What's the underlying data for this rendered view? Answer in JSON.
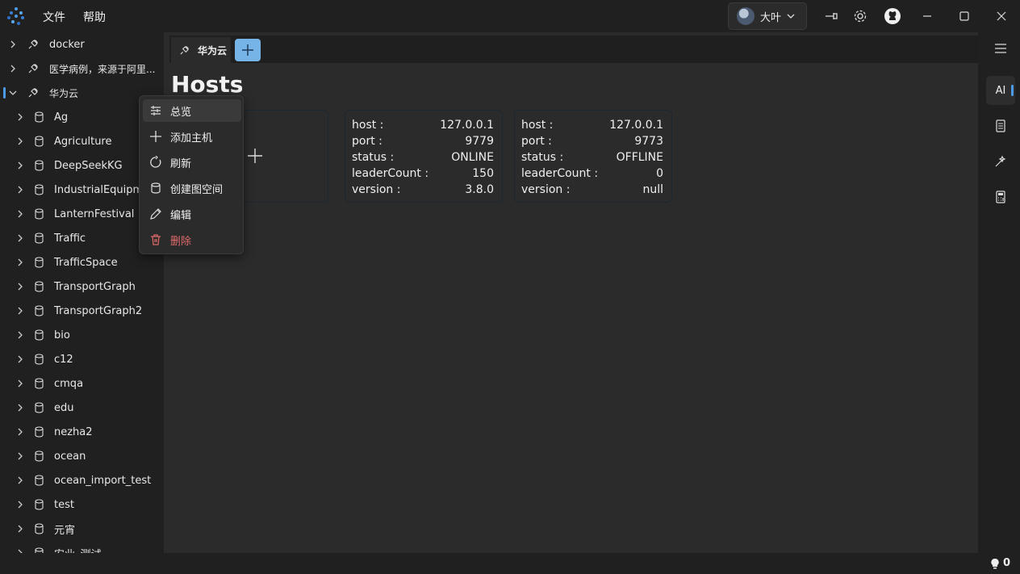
{
  "menu": {
    "file": "文件",
    "help": "帮助"
  },
  "user": {
    "name": "大叶"
  },
  "sidebar": {
    "connections": [
      {
        "label": "docker",
        "expanded": false
      },
      {
        "label": "医学病例，来源于阿里...",
        "expanded": false
      },
      {
        "label": "华为云",
        "expanded": true,
        "selected": true
      }
    ],
    "spaces": [
      "Ag",
      "Agriculture",
      "DeepSeekKG",
      "IndustrialEquipmen",
      "LanternFestival",
      "Traffic",
      "TrafficSpace",
      "TransportGraph",
      "TransportGraph2",
      "bio",
      "c12",
      "cmqa",
      "edu",
      "nezha2",
      "ocean",
      "ocean_import_test",
      "test",
      "元宵",
      "安业_测试"
    ]
  },
  "tabs": [
    {
      "label": "华为云"
    }
  ],
  "page": {
    "title": "Hosts"
  },
  "hosts": [
    {
      "host": "127.0.0.1",
      "port": "9779",
      "status": "ONLINE",
      "leaderCount": "150",
      "version": "3.8.0"
    },
    {
      "host": "127.0.0.1",
      "port": "9773",
      "status": "OFFLINE",
      "leaderCount": "0",
      "version": "null"
    }
  ],
  "host_labels": {
    "host": "host :",
    "port": "port :",
    "status": "status :",
    "leaderCount": "leaderCount :",
    "version": "version :"
  },
  "context_menu": {
    "items": [
      {
        "label": "总览",
        "icon": "overview-icon"
      },
      {
        "label": "添加主机",
        "icon": "plus-icon"
      },
      {
        "label": "刷新",
        "icon": "refresh-icon"
      },
      {
        "label": "创建图空间",
        "icon": "database-icon"
      },
      {
        "label": "编辑",
        "icon": "pencil-icon"
      },
      {
        "label": "删除",
        "icon": "trash-icon",
        "danger": true
      }
    ]
  },
  "rightbar": {
    "ai_label": "AI"
  },
  "status": {
    "count": "0"
  },
  "colors": {
    "accent": "#76b3e6",
    "danger": "#e06a6a",
    "selection": "#4c9be8"
  }
}
